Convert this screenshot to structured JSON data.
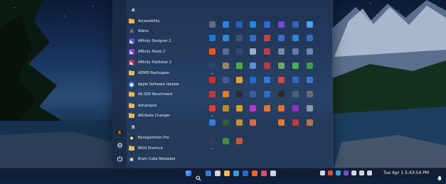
{
  "start_menu": {
    "letters": [
      "A",
      "B"
    ],
    "apps": [
      {
        "label": "Accessibility",
        "type": "folder",
        "expand": "⌄"
      },
      {
        "label": "Adera",
        "type": "app",
        "color": "#2d3a52",
        "glyph": "Λ"
      },
      {
        "label": "Affinity Designer 2",
        "type": "app",
        "color": "#5b4fd6",
        "glyph": "◣"
      },
      {
        "label": "Affinity Photo 2",
        "type": "app",
        "color": "#8b44c9",
        "glyph": "◣"
      },
      {
        "label": "Affinity Publisher 2",
        "type": "app",
        "color": "#b3395b",
        "glyph": "◣"
      },
      {
        "label": "AOMEI Backupper",
        "type": "folder",
        "expand": "⌄"
      },
      {
        "label": "Apple Software Update",
        "type": "app",
        "color": "#3b7ddb",
        "glyph": "●"
      },
      {
        "label": "AS SSD Benchmark",
        "type": "folder",
        "expand": "⌄"
      },
      {
        "label": "Ashampoo",
        "type": "folder",
        "expand": "⌄"
      },
      {
        "label": "Attribute Changer",
        "type": "folder",
        "expand": "⌄"
      },
      {
        "label": "Backgammon Pro",
        "type": "app",
        "color": "#3a2a20",
        "glyph": "◉"
      },
      {
        "label": "BIOS Shortcut",
        "type": "folder",
        "expand": "⌄"
      },
      {
        "label": "Brain Cube Reloaded",
        "type": "app",
        "color": "#1f3b66",
        "glyph": "▣"
      }
    ],
    "rail_icons": [
      "user-avatar-icon",
      "settings-icon",
      "power-icon"
    ]
  },
  "pinned_tiles": [
    [
      "#5a6c86",
      "#2f7fe0",
      "#2c5fb0",
      "#1f8ad8",
      "#2c6bd8",
      "#7b45d6",
      "#2d66b8",
      "#4aa0e6"
    ],
    [
      "#1d7ad4",
      "#2a8cd8",
      "#3c5478",
      "#2b6fd0",
      "#d83b3b",
      "#3b6fd6",
      "#2a8ad8",
      "#3a66c4"
    ],
    [
      "#e8551f",
      "#5a6f8c",
      "#2f4a6e",
      "#9ab0c8",
      "#c23a4a",
      "#7a8aa4",
      "#5e7ea6",
      "#6a88aa"
    ],
    [
      "#2e4466",
      "#9a8466",
      "#4fa84a",
      "#5b8ad6",
      "#c03838",
      "#73a85a",
      "#4cae4c",
      "#3c9e48"
    ],
    [
      "#c8342a",
      "#3d5e96",
      "#e0a23a",
      "#1f6fd0",
      "#2a78d8",
      "#d84a3c",
      "#2d69c8",
      "#3a76d0"
    ],
    [
      "#b8403a",
      "#e27a2a",
      "#2a2a3a",
      "#3a5ea6",
      "#2f6dcc",
      "#2b2b2b",
      "#4c5f7a",
      "#6a6a7a"
    ],
    [
      "#d83c3c",
      "#c08a2a",
      "#d0a23c",
      "#b23ad0",
      "#e8762a",
      "#e0702c",
      "#9a2ac8",
      "#8a9ab0"
    ],
    [
      "#3a7ad8",
      "#355a3a",
      "#c2903a",
      "#d46a4a",
      "#2a3a5a",
      "#e27c2a",
      "#c23a3a",
      "#b8763a"
    ],
    [
      "#2c3e5a",
      "#4a8a4a",
      "#c05a3a"
    ]
  ],
  "taskbar": {
    "clock": "Tue Apr 1   5:43:54 PM",
    "center_icons": [
      "#3a78d8",
      "#cfd6e2",
      "#e9b949",
      "#3a9ad8",
      "#2a6ad0",
      "#e06a2a",
      "#d84a7a",
      "#cfd6e2"
    ],
    "tray_icons": [
      "#cfd6e2",
      "#e04a3a",
      "#3aa0e0",
      "#7a4ad6",
      "#cfd6e2",
      "#cfd6e2",
      "#cfd6e2"
    ]
  }
}
